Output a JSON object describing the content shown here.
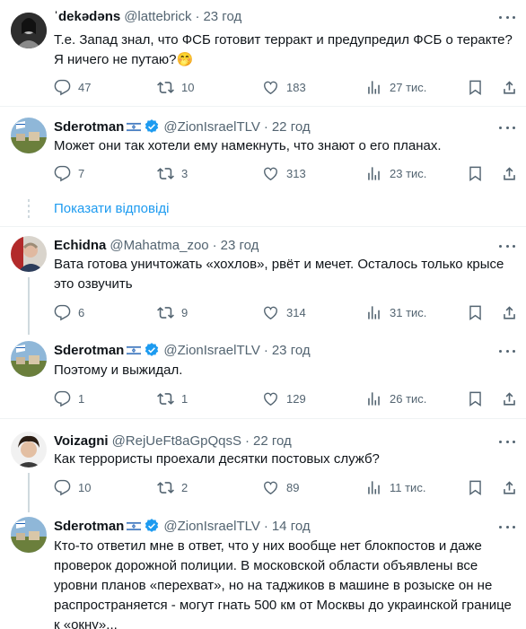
{
  "show_replies_label": "Показати відповіді",
  "colors": {
    "accent": "#1d9bf0",
    "secondary_text": "#536471",
    "verified": "#1d9bf0"
  },
  "tweets": [
    {
      "name": "ˈdekədəns",
      "handle": "@lattebrick",
      "time": "23 год",
      "text": "Т.е. Запад знал, что ФСБ готовит терракт и предупредил ФСБ о теракте? Я ничего не путаю?🤭",
      "replies": "47",
      "retweets": "10",
      "likes": "183",
      "views": "27 тис."
    },
    {
      "name": "Sderotman",
      "handle": "@ZionIsraelTLV",
      "time": "22 год",
      "text": "Может они так хотели ему намекнуть, что знают о его планах.",
      "replies": "7",
      "retweets": "3",
      "likes": "313",
      "views": "23 тис."
    },
    {
      "name": "Echidna",
      "handle": "@Mahatma_zoo",
      "time": "23 год",
      "text": "Вата готова уничтожать «хохлов», рвёт и мечет. Осталось только крысе это озвучить",
      "replies": "6",
      "retweets": "9",
      "likes": "314",
      "views": "31 тис."
    },
    {
      "name": "Sderotman",
      "handle": "@ZionIsraelTLV",
      "time": "23 год",
      "text": "Поэтому и выжидал.",
      "replies": "1",
      "retweets": "1",
      "likes": "129",
      "views": "26 тис."
    },
    {
      "name": "Voizagni",
      "handle": "@RejUeFt8aGpQqsS",
      "time": "22 год",
      "text": "Как террористы проехали десятки постовых служб?",
      "replies": "10",
      "retweets": "2",
      "likes": "89",
      "views": "11 тис."
    },
    {
      "name": "Sderotman",
      "handle": "@ZionIsraelTLV",
      "time": "14 год",
      "text": "Кто-то ответил мне в ответ, что у них вообще нет блокпостов и даже проверок дорожной полиции. В московской области объявлены все уровни планов «перехват», но на таджиков в машине в розыске он не распространяется - могут гнать 500 км от Москвы до украинской границе к «окну»...",
      "replies": "",
      "retweets": "",
      "likes": "",
      "views": ""
    }
  ]
}
